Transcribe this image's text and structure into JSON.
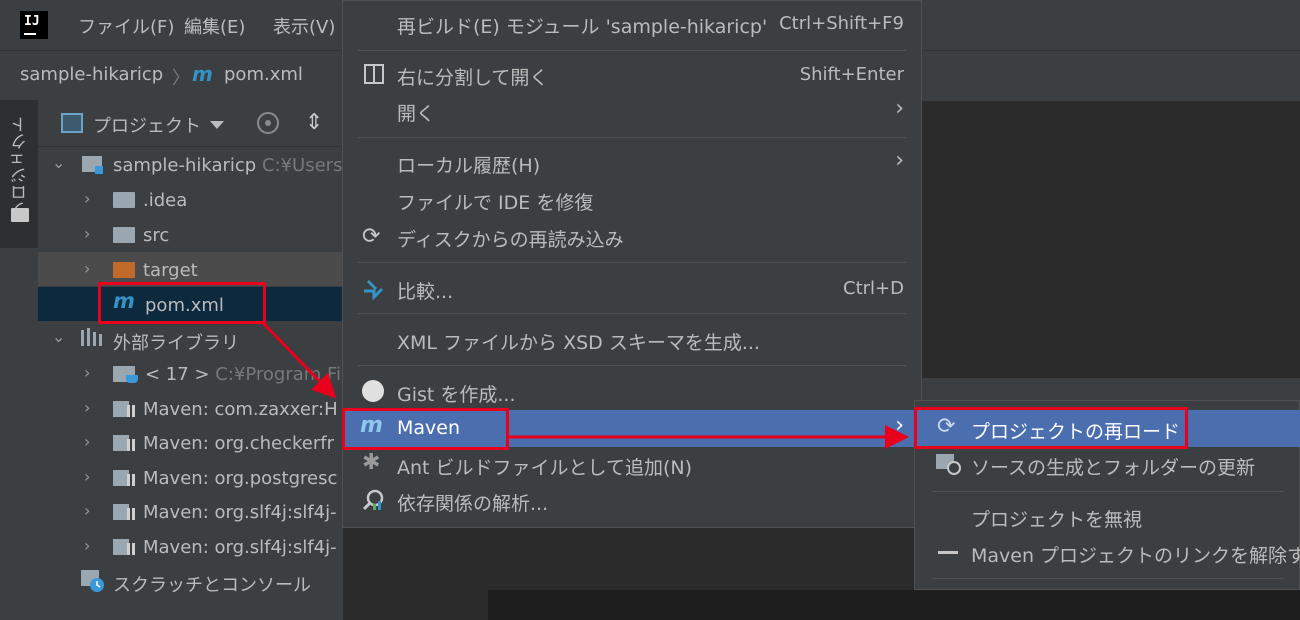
{
  "menubar": {
    "items": [
      "ファイル(F)",
      "編集(E)",
      "表示(V)"
    ]
  },
  "breadcrumb": {
    "project": "sample-hikaricp",
    "file": "pom.xml"
  },
  "side": {
    "tab_label": "プロジェクト"
  },
  "panel": {
    "title": "プロジェクト",
    "tree": [
      {
        "label": "sample-hikaricp",
        "hint": "C:¥Users"
      },
      {
        "label": ".idea"
      },
      {
        "label": "src"
      },
      {
        "label": "target"
      },
      {
        "label": "pom.xml"
      },
      {
        "label": "外部ライブラリ"
      },
      {
        "label": "< 17 >",
        "hint": "C:¥Program Fi"
      },
      {
        "label": "Maven: com.zaxxer:H"
      },
      {
        "label": "Maven: org.checkerfr"
      },
      {
        "label": "Maven: org.postgresc"
      },
      {
        "label": "Maven: org.slf4j:slf4j-"
      },
      {
        "label": "Maven: org.slf4j:slf4j-"
      },
      {
        "label": "スクラッチとコンソール"
      }
    ]
  },
  "context_menu": {
    "items": [
      {
        "label": "再ビルド(E) モジュール 'sample-hikaricp'",
        "shortcut": "Ctrl+Shift+F9"
      },
      {
        "label": "右に分割して開く",
        "shortcut": "Shift+Enter"
      },
      {
        "label": "開く",
        "shortcut": "›"
      },
      {
        "label": "ローカル履歴(H)",
        "shortcut": "›"
      },
      {
        "label": "ファイルで IDE を修復",
        "shortcut": ""
      },
      {
        "label": "ディスクからの再読み込み",
        "shortcut": ""
      },
      {
        "label": "比較...",
        "shortcut": "Ctrl+D"
      },
      {
        "label": "XML ファイルから XSD スキーマを生成...",
        "shortcut": ""
      },
      {
        "label": "Gist を作成...",
        "shortcut": ""
      },
      {
        "label": "Maven",
        "shortcut": "›"
      },
      {
        "label": "Ant ビルドファイルとして追加(N)",
        "shortcut": ""
      },
      {
        "label": "依存関係の解析...",
        "shortcut": ""
      }
    ]
  },
  "submenu": {
    "items": [
      {
        "label": "プロジェクトの再ロード"
      },
      {
        "label": "ソースの生成とフォルダーの更新"
      },
      {
        "label": "プロジェクトを無視"
      },
      {
        "label": "Maven プロジェクトのリンクを解除する"
      }
    ]
  },
  "colors": {
    "selection": "#4b6eaf",
    "annotation_red": "#e8001c",
    "maven_blue": "#3592c4"
  }
}
